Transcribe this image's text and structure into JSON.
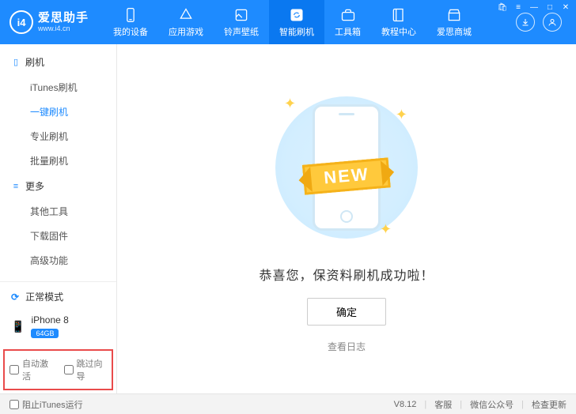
{
  "brand": {
    "name": "爱思助手",
    "url": "www.i4.cn",
    "logo_letters": "i4"
  },
  "nav": [
    {
      "label": "我的设备"
    },
    {
      "label": "应用游戏"
    },
    {
      "label": "铃声壁纸"
    },
    {
      "label": "智能刷机",
      "active": true
    },
    {
      "label": "工具箱"
    },
    {
      "label": "教程中心"
    },
    {
      "label": "爱思商城"
    }
  ],
  "sidebar": {
    "group_flash": "刷机",
    "flash_items": [
      {
        "label": "iTunes刷机"
      },
      {
        "label": "一键刷机",
        "active": true
      },
      {
        "label": "专业刷机"
      },
      {
        "label": "批量刷机"
      }
    ],
    "group_more": "更多",
    "more_items": [
      {
        "label": "其他工具"
      },
      {
        "label": "下载固件"
      },
      {
        "label": "高级功能"
      }
    ],
    "mode_label": "正常模式",
    "device_name": "iPhone 8",
    "device_capacity": "64GB",
    "chk_auto_activate": "自动激活",
    "chk_skip_guide": "跳过向导"
  },
  "content": {
    "ribbon_text": "NEW",
    "success_text": "恭喜您，保资料刷机成功啦！",
    "ok_label": "确定",
    "view_log_label": "查看日志"
  },
  "footer": {
    "block_itunes": "阻止iTunes运行",
    "version": "V8.12",
    "support": "客服",
    "wechat": "微信公众号",
    "update": "检查更新"
  }
}
